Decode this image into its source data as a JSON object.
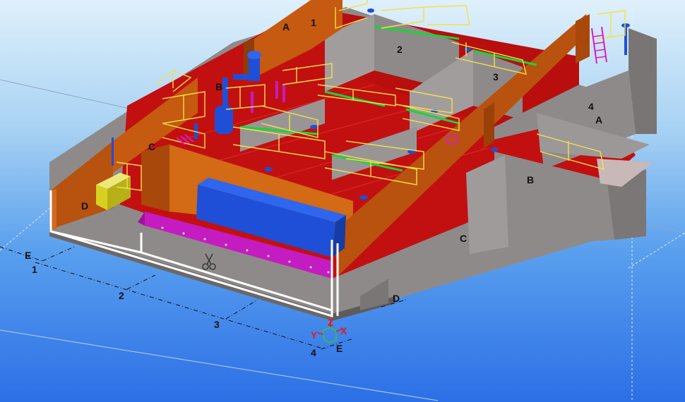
{
  "viewport": {
    "background_top": "#dff0fb",
    "background_bottom": "#2c6fe6"
  },
  "colors": {
    "wall_orange": "#c55a10",
    "floor_red": "#c21010",
    "concrete_gray": "#8f8a8a",
    "handrail_yellow": "#f2e14a",
    "equipment_blue": "#1f4fd6",
    "grating_magenta": "#c41cc0",
    "box_yellow": "#d7d020"
  },
  "labels": {
    "a_top": "A",
    "one_top": "1",
    "two_mid": "2",
    "three_mid": "3",
    "four_right": "4",
    "a_right": "A",
    "b_left": "B",
    "b_right": "B",
    "c_left": "C",
    "c_right": "C",
    "d_left": "D",
    "d_bottom": "D"
  },
  "grid_labels": {
    "e_left": "E",
    "one": "1",
    "two": "2",
    "three": "3",
    "four": "4",
    "e_bottom": "E"
  },
  "axis_triad": {
    "z": "Z",
    "y": "Y",
    "x": "X"
  },
  "icons": {
    "cut_tool": "scissors-icon",
    "triad": "coordinate-axis-icon"
  }
}
